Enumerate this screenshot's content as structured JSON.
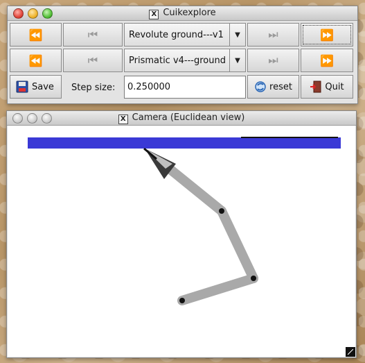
{
  "main_window": {
    "title": "Cuikexplore",
    "row1": {
      "combo_value": "Revolute ground---v1"
    },
    "row2": {
      "combo_value": "Prismatic v4---ground"
    },
    "save_label": "Save",
    "step_label": "Step size:",
    "step_value": "0.250000",
    "reset_label": "reset",
    "quit_label": "Quit",
    "icons": {
      "fast_back": "⏪",
      "step_back": "⏮",
      "step_fwd": "⏭",
      "fast_fwd": "⏩",
      "dropdown": "▼",
      "x_logo": "X"
    }
  },
  "camera_window": {
    "title": "Camera (Euclidean view)",
    "colors": {
      "ground": "#3a39d6",
      "link": "#a9a9a9",
      "joint": "#111111"
    }
  }
}
